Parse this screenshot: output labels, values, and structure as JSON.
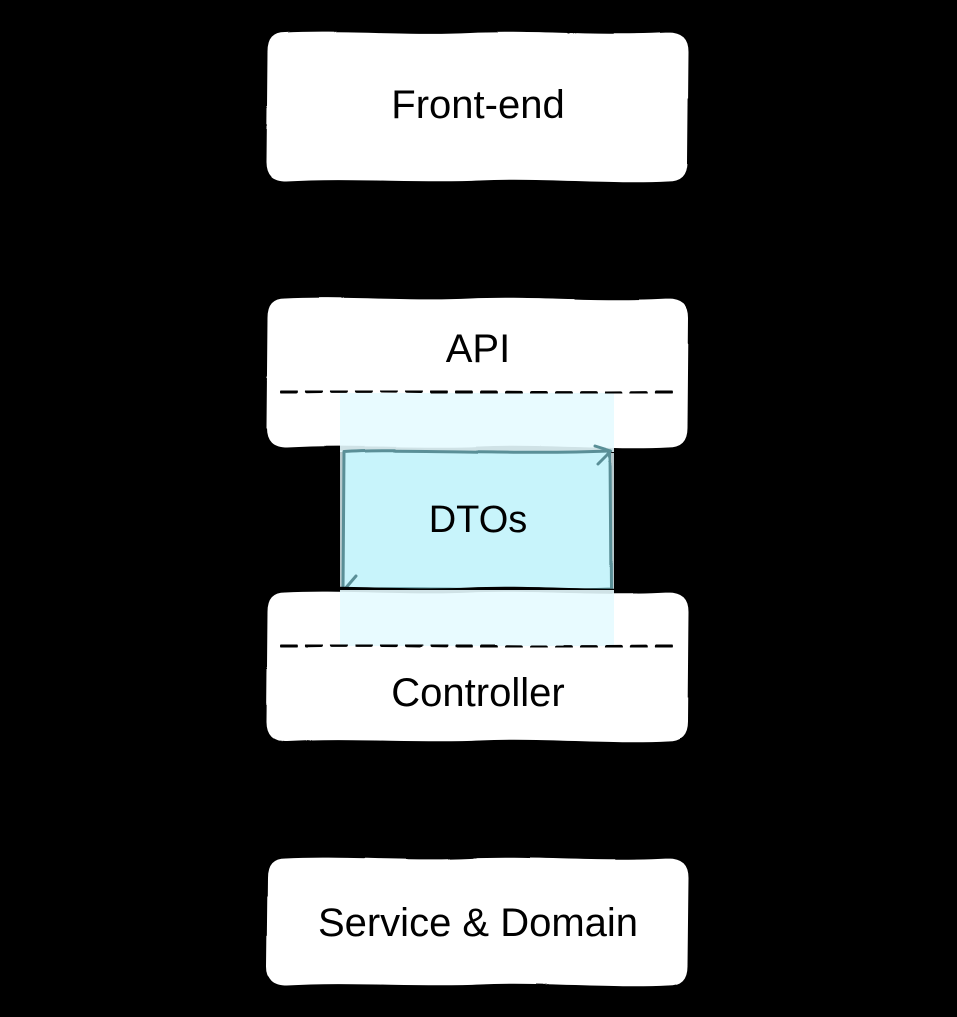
{
  "diagram": {
    "nodes": {
      "frontend": {
        "label": "Front-end"
      },
      "api": {
        "label": "API"
      },
      "dtos": {
        "label": "DTOs"
      },
      "controller": {
        "label": "Controller"
      },
      "service_domain": {
        "label": "Service & Domain"
      }
    },
    "edges": {
      "frontend_api_down": {
        "label": ""
      },
      "api_frontend_up": {
        "label": ""
      },
      "controller_service_down": {
        "label": ""
      },
      "service_controller_up": {
        "label": ""
      }
    },
    "colors": {
      "box_fill": "#ffffff",
      "box_stroke": "#000000",
      "arrow_stroke": "#000000",
      "highlight_fill": "#c8f4fb",
      "highlight_halo": "#e6fbff"
    }
  }
}
